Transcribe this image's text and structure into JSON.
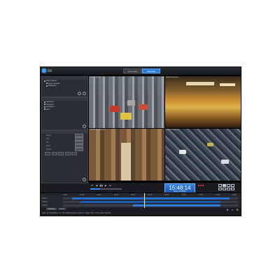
{
  "modes": [
    {
      "label": "Live View",
      "active": false
    },
    {
      "label": "Playback",
      "active": true
    }
  ],
  "sidebar": {
    "panel1_items": [
      "Event Server",
      "Front Camera",
      "Building A"
    ],
    "panel2_items": [
      "Camera 1",
      "Camera 2",
      "Camera 3",
      "PTZ"
    ],
    "panel3_fields": [
      "Preset",
      "Pan",
      "Tilt",
      "Zoom",
      "Speed"
    ]
  },
  "cameras": [
    {
      "label": "CAM 1 Street"
    },
    {
      "label": "CAM 2 Grocery"
    },
    {
      "label": "CAM 3 Warehouse"
    },
    {
      "label": "CAM 4 Parking"
    }
  ],
  "playback": {
    "time": "15:48:14",
    "date": "Friday 10/2/2013",
    "controls": [
      "⏮",
      "◀",
      "❚❚",
      "▶",
      "⏭"
    ],
    "slider_fraction": 0.3
  },
  "timeline": {
    "ticks": [
      "13:00",
      "13:30",
      "14:00",
      "14:30",
      "15:00",
      "15:30",
      "16:00",
      "16:30",
      "17:00",
      "17:30",
      "18:00"
    ],
    "tracks": [
      "Track 1",
      "Track 2",
      "Track 3"
    ],
    "tabs": [
      {
        "label": "Timeline",
        "active": true
      },
      {
        "label": "Events",
        "active": false
      }
    ]
  },
  "status": {
    "text": "Cam: 10 / 51328   Disk: 10 / 351 GB   Recording: Camera 1 Trigger   Rate: 25 fps   Used: 124 GB"
  },
  "colors": {
    "accent": "#2a7ad8",
    "record": "#d33333",
    "clock_bg": "#3580e0"
  },
  "icons": {
    "logo": "app-logo-icon",
    "tools": [
      "search-icon",
      "settings-icon"
    ],
    "status": [
      "arrow-icon",
      "search-icon",
      "gear-icon"
    ]
  }
}
